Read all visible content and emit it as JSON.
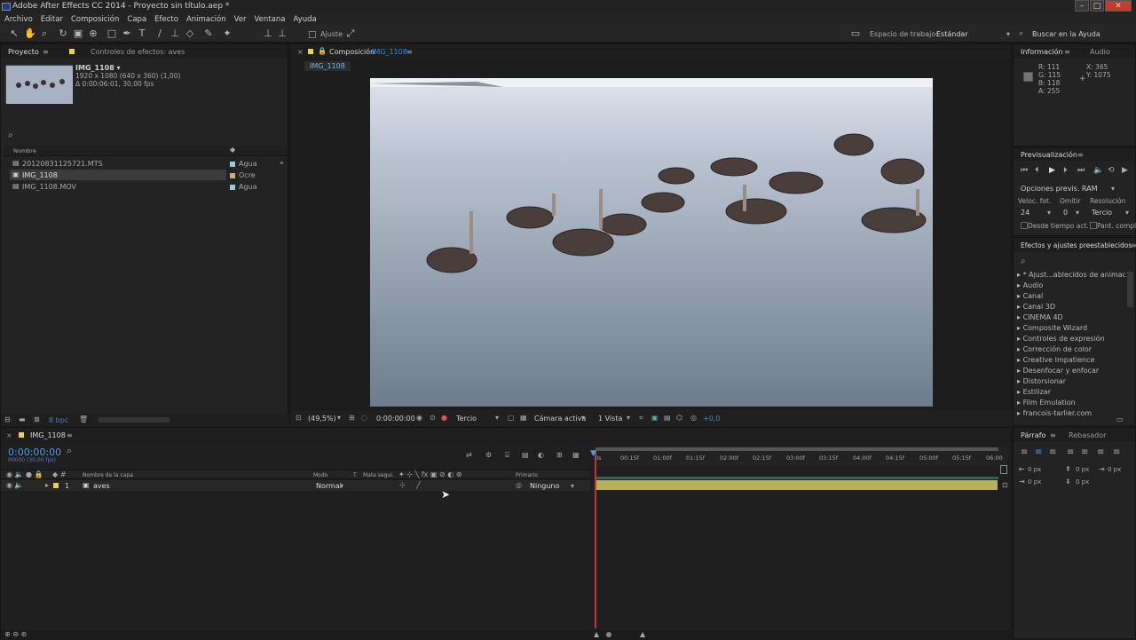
{
  "window": {
    "title": "Adobe After Effects CC 2014 - Proyecto sin título.aep *"
  },
  "menu": [
    "Archivo",
    "Editar",
    "Composición",
    "Capa",
    "Efecto",
    "Animación",
    "Ver",
    "Ventana",
    "Ayuda"
  ],
  "toolbar": {
    "adjust": "Ajuste",
    "workspace_label": "Espacio de trabajo:",
    "workspace_value": "Estándar",
    "help_search": "Buscar en la Ayuda"
  },
  "project": {
    "tab": "Proyecto",
    "tab2": "Controles de efectos: aves",
    "selected_name": "IMG_1108 ▾",
    "selected_info1": "1920 x 1080 (640 x 360) (1,00)",
    "selected_info2": "Δ 0:00:06:01, 30,00 fps",
    "col_name": "Nombre",
    "items": [
      {
        "name": "20120831125721.MTS",
        "label": "Agua"
      },
      {
        "name": "IMG_1108",
        "label": "Ocre"
      },
      {
        "name": "IMG_1108.MOV",
        "label": "Agua"
      }
    ],
    "bpc": "8 bpc"
  },
  "composition": {
    "tab": "Composición",
    "tab_name": "IMG_1108",
    "subtab": "IMG_1108",
    "zoom": "(49,5%)",
    "time": "0:00:00:00",
    "resolution": "Tercio",
    "camera": "Cámara activa",
    "views": "1 Vista",
    "exposure": "+0,0"
  },
  "info": {
    "tab": "Información",
    "tab2": "Audio",
    "R": "R: 111",
    "G": "G: 115",
    "B": "B: 118",
    "A": "A: 255",
    "X": "X: 365",
    "Y": "Y: 1075"
  },
  "preview": {
    "tab": "Previsualización",
    "ram": "Opciones previs. RAM",
    "fps_label": "Veloc. fot.",
    "skip_label": "Omitir",
    "res_label": "Resolución",
    "fps": "24",
    "skip": "0",
    "res": "Tercio",
    "from": "Desde tiempo act.",
    "full": "Pant. compl."
  },
  "effects": {
    "tab": "Efectos y ajustes preestablecidos",
    "items": [
      "* Ajust...ablecidos de animación",
      "Audio",
      "Canal",
      "Canal 3D",
      "CINEMA 4D",
      "Composite Wizard",
      "Controles de expresión",
      "Corrección de color",
      "Creative Impatience",
      "Desenfocar y enfocar",
      "Distorsionar",
      "Estilizar",
      "Film Emulation",
      "francois-tarlier.com"
    ]
  },
  "timeline": {
    "tab": "IMG_1108",
    "timecode": "0:00:00:00",
    "fps_small": "00000 (30,00 fps)",
    "col_layer": "Nombre de la capa",
    "col_mode": "Modo",
    "col_t": "T",
    "col_track": "Mate segui.",
    "col_parent": "Primario",
    "layer_index": "1",
    "layer_name": "aves",
    "layer_mode": "Normal",
    "layer_parent": "Ninguno",
    "ruler": [
      "0s",
      "00:15f",
      "01:00f",
      "01:15f",
      "02:00f",
      "02:15f",
      "03:00f",
      "03:15f",
      "04:00f",
      "04:15f",
      "05:00f",
      "05:15f",
      "06:00"
    ]
  },
  "paragraph": {
    "tab": "Párrafo",
    "tab2": "Rebasador",
    "px1": "0 px",
    "px2": "0 px",
    "px3": "0 px",
    "px4": "0 px",
    "px5": "0 px"
  }
}
